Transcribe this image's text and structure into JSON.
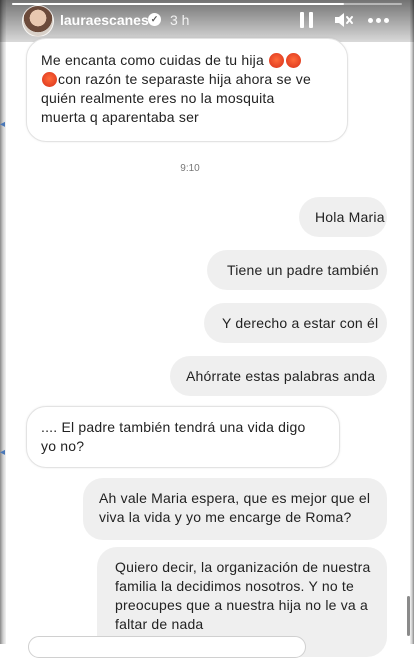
{
  "story": {
    "username": "lauraescanes",
    "time_ago": "3 h",
    "progress": 0.85,
    "icons": {
      "pause": "pause-icon",
      "mute": "mute-icon",
      "more": "more-icon",
      "verified": "verified-badge-icon"
    }
  },
  "chat": {
    "first_message": {
      "line1_pre": "Me encanta como cuidas de tu hija",
      "line2_post": "con razón te separaste hija ahora se ve",
      "line3": "quién realmente eres no la mosquita",
      "line4": "muerta q aparentaba ser"
    },
    "timestamp": "9:10",
    "messages": [
      {
        "side": "out",
        "text": "Hola Maria"
      },
      {
        "side": "out",
        "text": "Tiene un padre también"
      },
      {
        "side": "out",
        "text": "Y derecho a estar con él"
      },
      {
        "side": "out",
        "text": "Ahórrate estas palabras anda"
      },
      {
        "side": "in",
        "line1": ".... El padre también tendrá una vida digo",
        "line2": "yo no?"
      },
      {
        "side": "out",
        "line1": "Ah vale Maria espera, que es mejor que el",
        "line2": "viva la vida y yo me encarge de Roma?"
      },
      {
        "side": "out",
        "line1": "Quiero decir, la organización de nuestra",
        "line2": "familia la decidimos nosotros. Y no te",
        "line3": "preocupes que a nuestra hija no le va a",
        "line4": "faltar de nada"
      }
    ]
  }
}
